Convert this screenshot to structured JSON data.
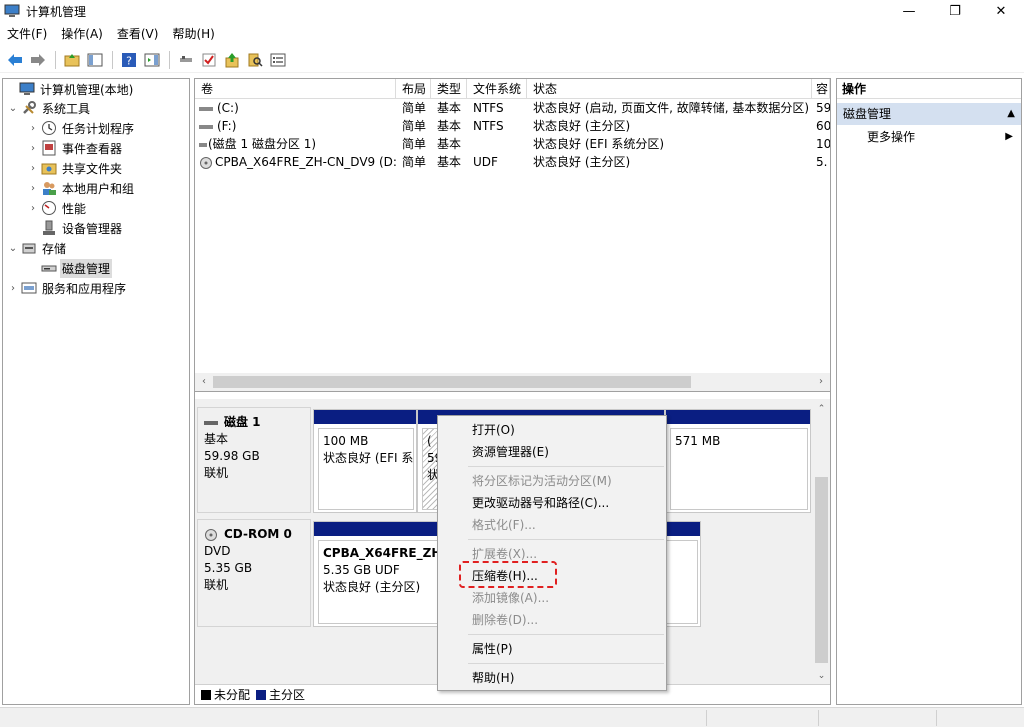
{
  "window": {
    "title": "计算机管理",
    "controls": {
      "minimize": "—",
      "maximize": "❐",
      "close": "✕"
    }
  },
  "menu": [
    "文件(F)",
    "操作(A)",
    "查看(V)",
    "帮助(H)"
  ],
  "toolbar": {
    "icons": [
      "back-arrow-icon",
      "forward-arrow-icon",
      "up-folder-icon",
      "show-hide-tree-icon",
      "help-icon",
      "action-pane-icon",
      "connect-icon",
      "check-icon",
      "export-icon",
      "search-icon",
      "properties-icon"
    ]
  },
  "tree": {
    "items": [
      {
        "label": "计算机管理(本地)",
        "level": 0,
        "expander": "",
        "icon": "computer-icon"
      },
      {
        "label": "系统工具",
        "level": 1,
        "expander": "⌄",
        "icon": "tools-icon"
      },
      {
        "label": "任务计划程序",
        "level": 2,
        "expander": "›",
        "icon": "clock-icon"
      },
      {
        "label": "事件查看器",
        "level": 2,
        "expander": "›",
        "icon": "event-viewer-icon"
      },
      {
        "label": "共享文件夹",
        "level": 2,
        "expander": "›",
        "icon": "shared-folder-icon"
      },
      {
        "label": "本地用户和组",
        "level": 2,
        "expander": "›",
        "icon": "users-icon"
      },
      {
        "label": "性能",
        "level": 2,
        "expander": "›",
        "icon": "performance-icon"
      },
      {
        "label": "设备管理器",
        "level": 2,
        "expander": "",
        "icon": "device-manager-icon"
      },
      {
        "label": "存储",
        "level": 1,
        "expander": "⌄",
        "icon": "storage-icon"
      },
      {
        "label": "磁盘管理",
        "level": 2,
        "expander": "",
        "icon": "disk-icon",
        "selected": true
      },
      {
        "label": "服务和应用程序",
        "level": 1,
        "expander": "›",
        "icon": "services-icon"
      }
    ]
  },
  "volumes": {
    "columns": [
      "卷",
      "布局",
      "类型",
      "文件系统",
      "状态",
      "容"
    ],
    "rows": [
      {
        "name": "(C:)",
        "layout": "简单",
        "type": "基本",
        "fs": "NTFS",
        "status": "状态良好 (启动, 页面文件, 故障转储, 基本数据分区)",
        "cap": "59"
      },
      {
        "name": "(F:)",
        "layout": "简单",
        "type": "基本",
        "fs": "NTFS",
        "status": "状态良好 (主分区)",
        "cap": "60"
      },
      {
        "name": "(磁盘 1 磁盘分区 1)",
        "layout": "简单",
        "type": "基本",
        "fs": "",
        "status": "状态良好 (EFI 系统分区)",
        "cap": "10"
      },
      {
        "name": "CPBA_X64FRE_ZH-CN_DV9 (D:)",
        "layout": "简单",
        "type": "基本",
        "fs": "UDF",
        "status": "状态良好 (主分区)",
        "cap": "5."
      }
    ]
  },
  "disks": [
    {
      "name": "磁盘 1",
      "kind": "基本",
      "size": "59.98 GB",
      "state": "联机",
      "partitions": [
        {
          "line1": "",
          "line2": "100 MB",
          "line3": "状态良好 (EFI 系"
        },
        {
          "line1": "(",
          "line2": "59",
          "line3": "状"
        },
        {
          "line1": "",
          "line2": "571 MB",
          "line3": ""
        }
      ]
    },
    {
      "name": "CD-ROM 0",
      "kind": "DVD",
      "size": "5.35 GB",
      "state": "联机",
      "partitions": [
        {
          "line1": "CPBA_X64FRE_ZH-C",
          "line2": "5.35 GB UDF",
          "line3": "状态良好 (主分区)"
        }
      ]
    }
  ],
  "legend": [
    {
      "label": "未分配",
      "color": "#000000"
    },
    {
      "label": "主分区",
      "color": "#0a1e82"
    }
  ],
  "actions": {
    "header": "操作",
    "section": "磁盘管理",
    "more": "更多操作"
  },
  "context_menu": {
    "items": [
      {
        "label": "打开(O)",
        "enabled": true
      },
      {
        "label": "资源管理器(E)",
        "enabled": true
      },
      {
        "label": "将分区标记为活动分区(M)",
        "enabled": false
      },
      {
        "label": "更改驱动器号和路径(C)...",
        "enabled": true
      },
      {
        "label": "格式化(F)...",
        "enabled": false
      },
      {
        "label": "扩展卷(X)...",
        "enabled": false
      },
      {
        "label": "压缩卷(H)...",
        "enabled": true,
        "highlighted": true
      },
      {
        "label": "添加镜像(A)...",
        "enabled": false
      },
      {
        "label": "删除卷(D)...",
        "enabled": false
      },
      {
        "label": "属性(P)",
        "enabled": true
      },
      {
        "label": "帮助(H)",
        "enabled": true
      }
    ]
  },
  "colors": {
    "primary_partition": "#0a1e82",
    "selection": "#d4e0f0",
    "highlight_border": "#e02020"
  }
}
